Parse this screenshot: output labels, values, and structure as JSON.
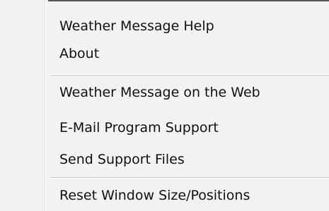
{
  "menu": {
    "items": [
      {
        "label": "Weather Message Help"
      },
      {
        "label": "About"
      },
      {
        "label": "Weather Message on the Web"
      },
      {
        "label": "E-Mail Program Support"
      },
      {
        "label": "Send Support Files"
      },
      {
        "label": "Reset Window Size/Positions"
      }
    ]
  },
  "colors": {
    "background": "#f2f2f2",
    "text": "#111111",
    "separator": "#c7c7c7"
  }
}
